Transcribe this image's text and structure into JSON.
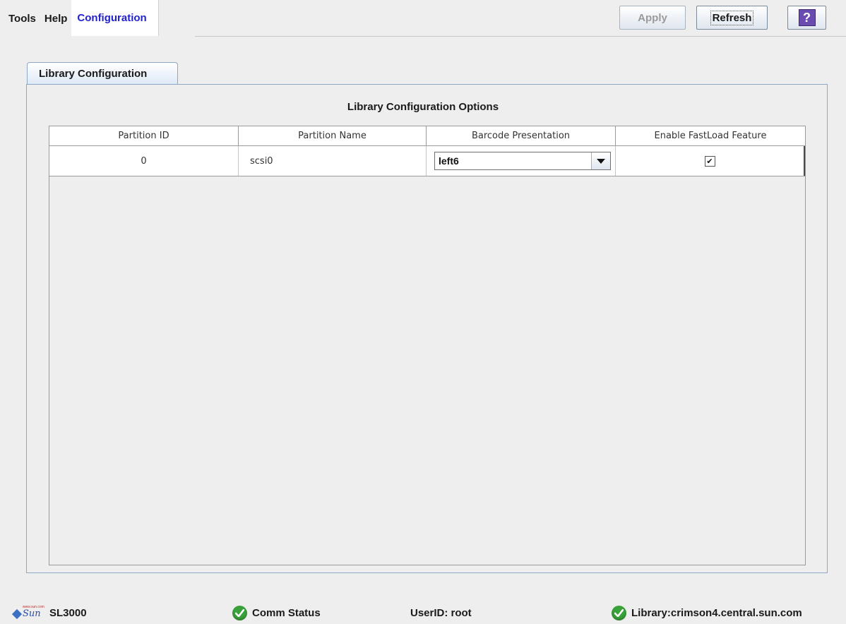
{
  "menu": {
    "tools": "Tools",
    "help": "Help",
    "configuration": "Configuration"
  },
  "toolbar": {
    "apply_label": "Apply",
    "refresh_label": "Refresh",
    "help_icon": "?"
  },
  "tab": {
    "label": "Library Configuration"
  },
  "panel": {
    "title": "Library Configuration Options"
  },
  "table": {
    "columns": [
      "Partition ID",
      "Partition Name",
      "Barcode Presentation",
      "Enable FastLoad Feature"
    ],
    "rows": [
      {
        "partition_id": "0",
        "partition_name": "scsi0",
        "barcode_presentation": "left6",
        "fastload_enabled": true
      }
    ]
  },
  "status_bar": {
    "logo_text": "Sun",
    "logo_small_text": "www.sun.com",
    "library_model": "SL3000",
    "comm_status": "Comm Status",
    "user": "UserID: root",
    "library": "Library:crimson4.central.sun.com"
  },
  "colors": {
    "active_menu": "#2222cc",
    "status_ok": "#3aa23a",
    "tab_border": "#8fa7c7"
  }
}
